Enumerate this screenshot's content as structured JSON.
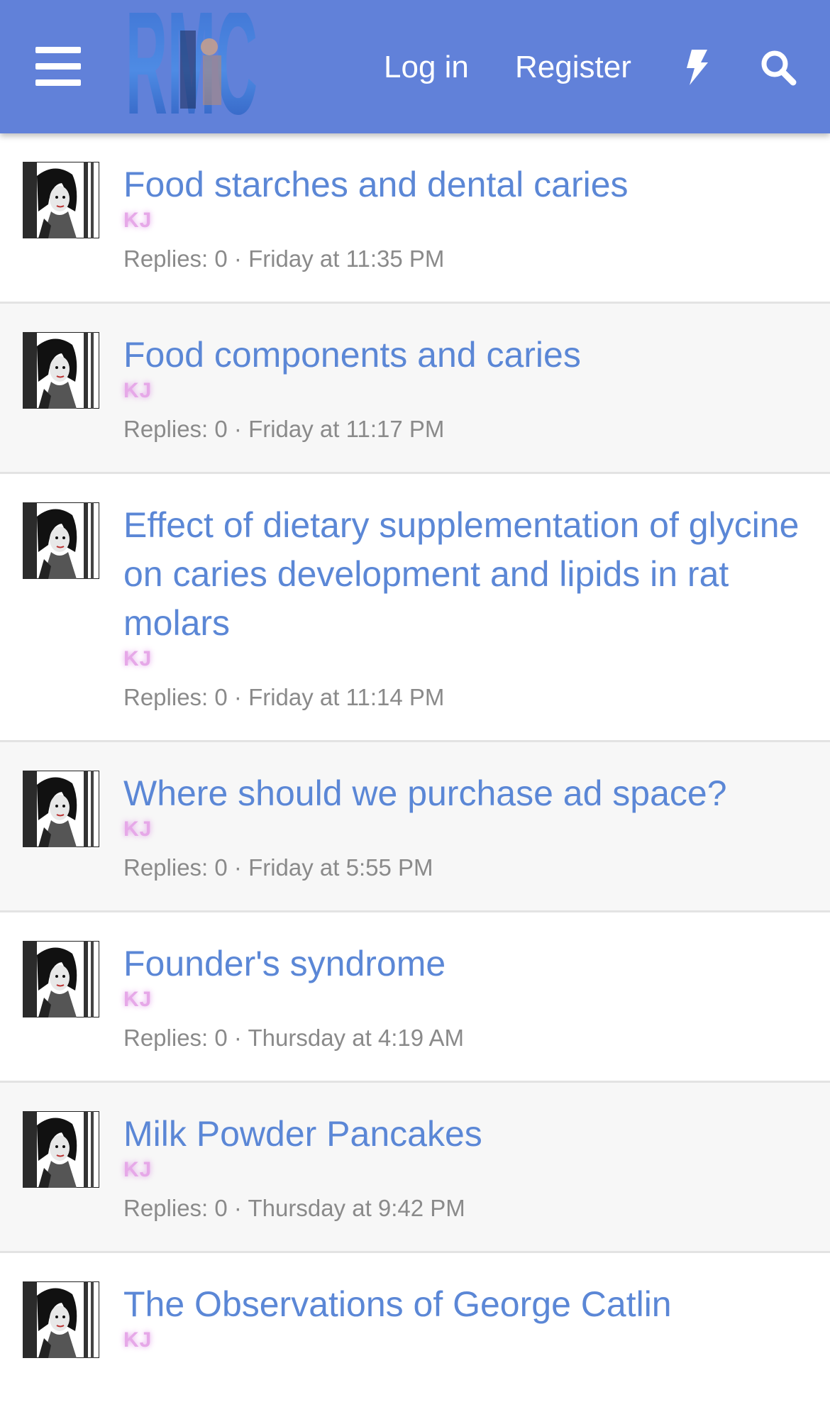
{
  "header": {
    "logo_text": "RMC",
    "login_label": "Log in",
    "register_label": "Register",
    "menu_icon": "hamburger-menu-icon",
    "bolt_icon": "lightning-bolt-icon",
    "search_icon": "search-icon",
    "background_color": "#6181d9"
  },
  "threads": [
    {
      "title": "Food starches and dental caries",
      "author": "KJ",
      "replies_label": "Replies: 0",
      "date": "Friday at 11:35 PM"
    },
    {
      "title": "Food components and caries",
      "author": "KJ",
      "replies_label": "Replies: 0",
      "date": "Friday at 11:17 PM"
    },
    {
      "title": "Effect of dietary supplementation of glycine on caries development and lipids in rat molars",
      "author": "KJ",
      "replies_label": "Replies: 0",
      "date": "Friday at 11:14 PM"
    },
    {
      "title": "Where should we purchase ad space?",
      "author": "KJ",
      "replies_label": "Replies: 0",
      "date": "Friday at 5:55 PM"
    },
    {
      "title": "Founder's syndrome",
      "author": "KJ",
      "replies_label": "Replies: 0",
      "date": "Thursday at 4:19 AM"
    },
    {
      "title": "Milk Powder Pancakes",
      "author": "KJ",
      "replies_label": "Replies: 0",
      "date": "Thursday at 9:42 PM"
    },
    {
      "title": "The Observations of George Catlin",
      "author": "KJ",
      "replies_label": "",
      "date": ""
    }
  ],
  "meta_separator": " · ",
  "colors": {
    "title_link": "#5b87d6",
    "author": "#e6a8e8",
    "meta_text": "#8a8a8a"
  }
}
